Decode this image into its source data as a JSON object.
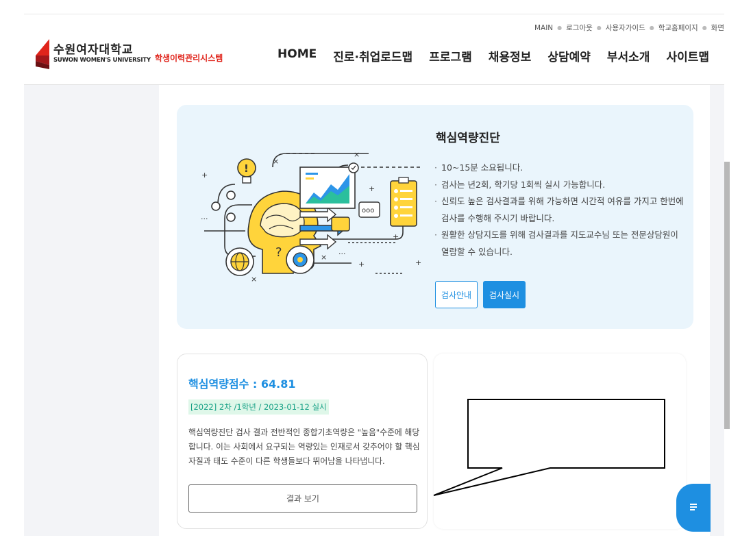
{
  "header": {
    "util_links": [
      "MAIN",
      "로그아웃",
      "사용자가이드",
      "학교홈페이지",
      "화면"
    ],
    "logo_ko": "수원여자대학교",
    "logo_en": "SUWON WOMEN'S UNIVERSITY",
    "system_name": "학생이력관리시스템",
    "nav": [
      "HOME",
      "진로·취업로드맵",
      "프로그램",
      "채용정보",
      "상담예약",
      "부서소개",
      "사이트맵"
    ]
  },
  "intro": {
    "title": "핵심역량진단",
    "bullets": [
      "10~15분 소요됩니다.",
      "검사는 년2회, 학기당 1회씩 실시 가능합니다.",
      "신뢰도 높은 검사결과를 위해 가능하면 시간적 여유를 가지고 한번에 검사를 수행해 주시기 바랍니다.",
      "원활한 상담지도를 위해 검사결과를 지도교수님 또는 전문상담원이 열람할 수 있습니다."
    ],
    "guide_button": "검사안내",
    "start_button": "검사실시"
  },
  "score": {
    "title": "핵심역량점수 : 64.81",
    "badge": "[2022] 2차 /1학년 / 2023-01-12 실시",
    "description": "핵심역량진단 검사 결과 전반적인 종합기초역량은 \"높음\"수준에 해당합니다. 이는 사회에서 요구되는 역량있는 인재로서 갖추어야 할 핵심 자질과 태도 수준이 다른 학생들보다 뛰어남을 나타냅니다.",
    "result_button": "결과 보기"
  },
  "colors": {
    "accent": "#1e8fe1",
    "brand_red": "#e0241b",
    "badge_bg": "#dff7e9",
    "badge_text": "#15a085",
    "intro_bg": "#eaf5fc"
  }
}
